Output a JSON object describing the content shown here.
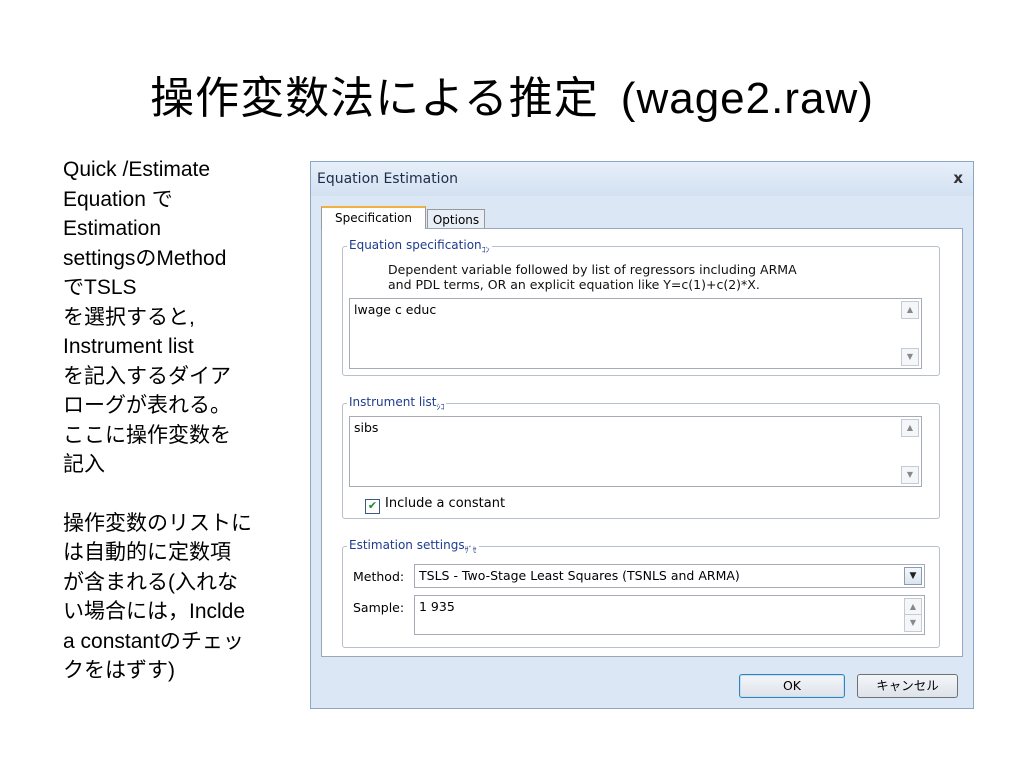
{
  "slide": {
    "title_main": "操作変数法による推定",
    "title_file": "(wage2.raw)",
    "left_text_lines": [
      "Quick /Estimate",
      "Equation で",
      "Estimation",
      "settingsのMethod",
      "でTSLS",
      "を選択すると,",
      "Instrument list",
      "を記入するダイア",
      "ローグが表れる。",
      "ここに操作変数を",
      "記入"
    ],
    "left_text_lines_2": [
      "操作変数のリストに",
      "は自動的に定数項",
      "が含まれる(入れな",
      "い場合には，Inclde",
      "a constantのチェッ",
      "クをはずす)"
    ]
  },
  "dialog": {
    "title": "Equation Estimation",
    "close_glyph": "x",
    "tabs": {
      "specification": "Specification",
      "options": "Options"
    },
    "equation_spec": {
      "legend": "Equation specification",
      "legend_sub": "ｺﾝ",
      "desc_line1": "Dependent variable followed by list of regressors including ARMA",
      "desc_line2": "and PDL terms, OR an explicit equation like Y=c(1)+c(2)*X.",
      "value": "lwage c educ"
    },
    "instrument": {
      "legend": "Instrument list",
      "legend_sub": "ｼｺ",
      "value": "sibs",
      "include_constant_label": "Include a constant",
      "include_constant_checked": "✔"
    },
    "estimation_settings": {
      "legend": "Estimation settings",
      "legend_sub": "ｻﾞｾ",
      "method_label": "Method:",
      "method_value": "TSLS  -  Two-Stage Least Squares (TSNLS and ARMA)",
      "sample_label": "Sample:",
      "sample_value": "1 935"
    },
    "buttons": {
      "ok": "OK",
      "cancel": "キャンセル"
    },
    "icons": {
      "scroll_up": "up-arrow-icon",
      "scroll_down": "down-arrow-icon",
      "dropdown": "chevron-down-icon",
      "check": "checkmark-icon"
    }
  }
}
